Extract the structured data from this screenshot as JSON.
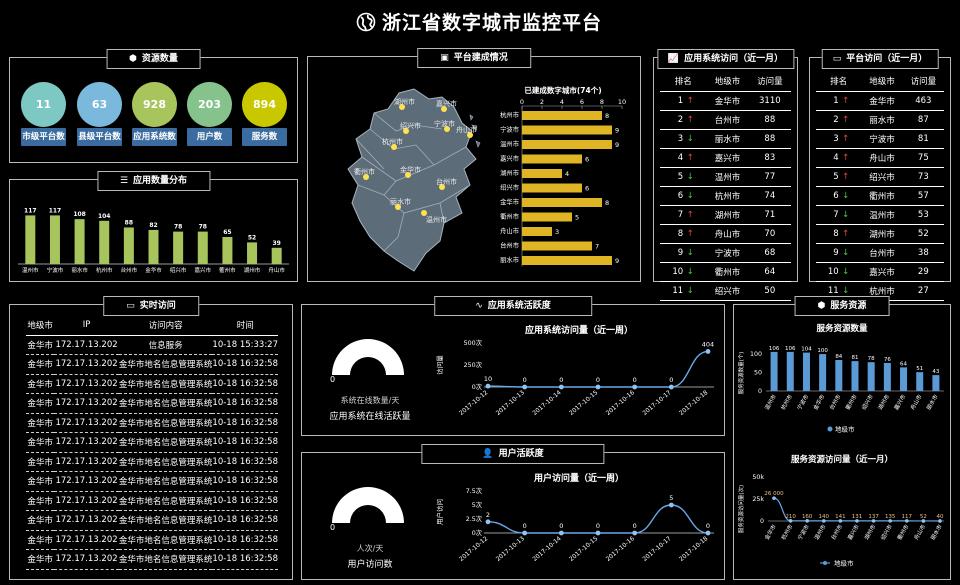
{
  "header": {
    "title": "浙江省数字城市监控平台",
    "icon": "globe-icon"
  },
  "resources": {
    "title": "资源数量",
    "icon": "cube-icon",
    "items": [
      {
        "value": "11",
        "label": "市级平台数",
        "color": "#7ec8c4"
      },
      {
        "value": "63",
        "label": "县级平台数",
        "color": "#7ab9dc"
      },
      {
        "value": "928",
        "label": "应用系统数",
        "color": "#a8c45c"
      },
      {
        "value": "203",
        "label": "用户数",
        "color": "#86c28c"
      },
      {
        "value": "894",
        "label": "服务数",
        "color": "#c9c700"
      }
    ]
  },
  "app_dist": {
    "title": "应用数量分布",
    "icon": "layers-icon",
    "chart_data": {
      "type": "bar",
      "categories": [
        "温州市",
        "宁波市",
        "丽水市",
        "杭州市",
        "台州市",
        "金华市",
        "绍兴市",
        "嘉兴市",
        "衢州市",
        "湖州市",
        "舟山市"
      ],
      "values": [
        117,
        117,
        108,
        104,
        88,
        82,
        78,
        78,
        65,
        52,
        39
      ],
      "color": "#a8c45c"
    }
  },
  "platform": {
    "title": "平台建成情况",
    "icon": "monitor-icon",
    "map_labels": [
      "湖州市",
      "嘉兴市",
      "绍兴市",
      "宁波市",
      "杭州市",
      "舟山市",
      "衢州市",
      "金华市",
      "台州市",
      "丽水市",
      "温州市"
    ],
    "chart_data": {
      "type": "bar",
      "title": "已建成数字城市(74个)",
      "categories": [
        "杭州市",
        "宁波市",
        "温州市",
        "嘉兴市",
        "湖州市",
        "绍兴市",
        "金华市",
        "衢州市",
        "舟山市",
        "台州市",
        "丽水市"
      ],
      "values": [
        8,
        9,
        9,
        6,
        4,
        6,
        8,
        5,
        3,
        7,
        9
      ],
      "xlim": [
        0,
        10
      ],
      "xticks": [
        "0",
        "2",
        "4",
        "6",
        "8",
        "10"
      ],
      "color": "#e0b525"
    }
  },
  "app_visit_rank": {
    "title": "应用系统访问（近一月）",
    "icon": "line-chart-icon",
    "columns": [
      "排名",
      "地级市",
      "访问量"
    ],
    "rows": [
      {
        "rank": "1",
        "dir": "↑",
        "city": "金华市",
        "count": "3110"
      },
      {
        "rank": "2",
        "dir": "↑",
        "city": "台州市",
        "count": "88"
      },
      {
        "rank": "3",
        "dir": "↓",
        "city": "丽水市",
        "count": "88"
      },
      {
        "rank": "4",
        "dir": "↑",
        "city": "嘉兴市",
        "count": "83"
      },
      {
        "rank": "5",
        "dir": "↓",
        "city": "温州市",
        "count": "77"
      },
      {
        "rank": "6",
        "dir": "↓",
        "city": "杭州市",
        "count": "74"
      },
      {
        "rank": "7",
        "dir": "↑",
        "city": "湖州市",
        "count": "71"
      },
      {
        "rank": "8",
        "dir": "↑",
        "city": "舟山市",
        "count": "70"
      },
      {
        "rank": "9",
        "dir": "↓",
        "city": "宁波市",
        "count": "68"
      },
      {
        "rank": "10",
        "dir": "↓",
        "city": "衢州市",
        "count": "64"
      },
      {
        "rank": "11",
        "dir": "↓",
        "city": "绍兴市",
        "count": "50"
      }
    ]
  },
  "platform_visit_rank": {
    "title": "平台访问（近一月）",
    "icon": "screen-icon",
    "columns": [
      "排名",
      "地级市",
      "访问量"
    ],
    "rows": [
      {
        "rank": "1",
        "dir": "↑",
        "city": "金华市",
        "count": "463"
      },
      {
        "rank": "2",
        "dir": "↑",
        "city": "丽水市",
        "count": "87"
      },
      {
        "rank": "3",
        "dir": "↑",
        "city": "宁波市",
        "count": "81"
      },
      {
        "rank": "4",
        "dir": "↑",
        "city": "舟山市",
        "count": "75"
      },
      {
        "rank": "5",
        "dir": "↑",
        "city": "绍兴市",
        "count": "73"
      },
      {
        "rank": "6",
        "dir": "↓",
        "city": "衢州市",
        "count": "57"
      },
      {
        "rank": "7",
        "dir": "↓",
        "city": "温州市",
        "count": "53"
      },
      {
        "rank": "8",
        "dir": "↑",
        "city": "湖州市",
        "count": "52"
      },
      {
        "rank": "9",
        "dir": "↓",
        "city": "台州市",
        "count": "38"
      },
      {
        "rank": "10",
        "dir": "↓",
        "city": "嘉兴市",
        "count": "29"
      },
      {
        "rank": "11",
        "dir": "↓",
        "city": "杭州市",
        "count": "27"
      }
    ]
  },
  "realtime": {
    "title": "实时访问",
    "icon": "screen-icon",
    "columns": [
      "地级市",
      "IP",
      "访问内容",
      "时间"
    ],
    "rows": [
      {
        "city": "金华市",
        "ip": "172.17.13.202",
        "content": "信息服务",
        "time": "10-18 15:33:27"
      },
      {
        "city": "金华市",
        "ip": "172.17.13.202",
        "content": "金华市地名信息管理系统",
        "time": "10-18 16:32:58"
      },
      {
        "city": "金华市",
        "ip": "172.17.13.202",
        "content": "金华市地名信息管理系统",
        "time": "10-18 16:32:58"
      },
      {
        "city": "金华市",
        "ip": "172.17.13.202",
        "content": "金华市地名信息管理系统",
        "time": "10-18 16:32:58"
      },
      {
        "city": "金华市",
        "ip": "172.17.13.202",
        "content": "金华市地名信息管理系统",
        "time": "10-18 16:32:58"
      },
      {
        "city": "金华市",
        "ip": "172.17.13.202",
        "content": "金华市地名信息管理系统",
        "time": "10-18 16:32:58"
      },
      {
        "city": "金华市",
        "ip": "172.17.13.202",
        "content": "金华市地名信息管理系统",
        "time": "10-18 16:32:58"
      },
      {
        "city": "金华市",
        "ip": "172.17.13.202",
        "content": "金华市地名信息管理系统",
        "time": "10-18 16:32:58"
      },
      {
        "city": "金华市",
        "ip": "172.17.13.202",
        "content": "金华市地名信息管理系统",
        "time": "10-18 16:32:58"
      },
      {
        "city": "金华市",
        "ip": "172.17.13.202",
        "content": "金华市地名信息管理系统",
        "time": "10-18 16:32:58"
      },
      {
        "city": "金华市",
        "ip": "172.17.13.202",
        "content": "金华市地名信息管理系统",
        "time": "10-18 16:32:58"
      },
      {
        "city": "金华市",
        "ip": "172.17.13.202",
        "content": "金华市地名信息管理系统",
        "time": "10-18 16:32:58"
      }
    ]
  },
  "app_activity": {
    "title": "应用系统活跃度",
    "icon": "pulse-icon",
    "gauge_value": "0",
    "gauge_unit": "系统在线数量/天",
    "gauge_label": "应用系统在线活跃量",
    "chart_data": {
      "type": "line",
      "title": "应用系统访问量（近一周）",
      "ylabel": "访问量",
      "x": [
        "2017-10-12",
        "2017-10-13",
        "2017-10-14",
        "2017-10-15",
        "2017-10-16",
        "2017-10-17",
        "2017-10-18"
      ],
      "values": [
        10,
        0,
        0,
        0,
        0,
        0,
        404
      ],
      "value_labels": [
        "10",
        "0",
        "0",
        "0",
        "0",
        "0",
        "404"
      ],
      "yticks": [
        "0次",
        "250次",
        "500次"
      ],
      "ylim": [
        0,
        500
      ]
    }
  },
  "user_activity": {
    "title": "用户活跃度",
    "icon": "user-icon",
    "gauge_value": "0",
    "gauge_unit": "人次/天",
    "gauge_label": "用户访问数",
    "chart_data": {
      "type": "line",
      "title": "用户访问量（近一周）",
      "ylabel": "用户访问",
      "x": [
        "2017-10-12",
        "2017-10-13",
        "2017-10-14",
        "2017-10-15",
        "2017-10-16",
        "2017-10-17",
        "2017-10-18"
      ],
      "values": [
        2,
        0,
        0,
        0,
        0,
        5,
        0
      ],
      "value_labels": [
        "2",
        "0",
        "0",
        "0",
        "0",
        "5",
        "0"
      ],
      "yticks": [
        "0次",
        "2.5次",
        "5次",
        "7.5次"
      ],
      "ylim": [
        0,
        7.5
      ]
    }
  },
  "services": {
    "title": "服务资源",
    "icon": "cube-icon",
    "bar_chart": {
      "type": "bar",
      "title": "服务资源数量",
      "ylabel": "服务资源数量(个)",
      "categories": [
        "温州市",
        "杭州市",
        "宁波市",
        "金华市",
        "台州市",
        "衢州市",
        "绍兴市",
        "湖州市",
        "嘉兴市",
        "舟山市",
        "丽水市"
      ],
      "values": [
        106,
        106,
        104,
        100,
        84,
        81,
        78,
        76,
        64,
        51,
        43
      ],
      "yticks": [
        "0",
        "50",
        "100"
      ],
      "ylim": [
        0,
        130
      ],
      "legend": "地级市",
      "color": "#5b9bd5"
    },
    "line_chart": {
      "type": "line",
      "title": "服务资源访问量（近一月）",
      "ylabel": "服务资源访问量(次)",
      "categories": [
        "金华市",
        "杭州市",
        "宁波市",
        "温州市",
        "台州市",
        "嘉兴市",
        "湖州市",
        "绍兴市",
        "衢州市",
        "舟山市",
        "丽水市"
      ],
      "values": [
        26000,
        210,
        160,
        140,
        141,
        131,
        137,
        135,
        117,
        52,
        40
      ],
      "value_labels": [
        "26 000",
        "210",
        "160",
        "140",
        "141",
        "131",
        "137",
        "135",
        "117",
        "52",
        "40"
      ],
      "yticks": [
        "0",
        "25k",
        "50k"
      ],
      "ylim": [
        0,
        50000
      ],
      "legend": "地级市",
      "color": "#5b9bd5"
    }
  }
}
